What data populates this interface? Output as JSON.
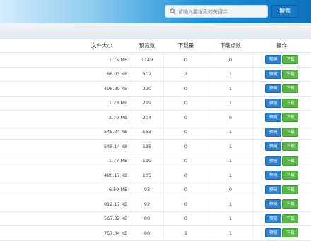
{
  "search": {
    "placeholder": "请输入要搜索的关键字...",
    "button_label": "搜索"
  },
  "table": {
    "columns": [
      "文件大小",
      "预览数",
      "下载量",
      "下载点数",
      "操作"
    ],
    "preview_label": "预览",
    "download_label": "下载",
    "rows": [
      {
        "size": "1.75 MB",
        "previews": "1149",
        "downloads": "0",
        "points": "0"
      },
      {
        "size": "88.03 KB",
        "previews": "302",
        "downloads": "2",
        "points": "1"
      },
      {
        "size": "495.89 KB",
        "previews": "290",
        "downloads": "0",
        "points": "1"
      },
      {
        "size": "1.23 MB",
        "previews": "219",
        "downloads": "0",
        "points": "1"
      },
      {
        "size": "2.70 MB",
        "previews": "204",
        "downloads": "0",
        "points": "0"
      },
      {
        "size": "545.24 KB",
        "previews": "163",
        "downloads": "0",
        "points": "1"
      },
      {
        "size": "545.14 KB",
        "previews": "135",
        "downloads": "0",
        "points": "1"
      },
      {
        "size": "1.77 MB",
        "previews": "119",
        "downloads": "0",
        "points": "1"
      },
      {
        "size": "480.17 KB",
        "previews": "105",
        "downloads": "0",
        "points": "1"
      },
      {
        "size": "6.59 MB",
        "previews": "93",
        "downloads": "0",
        "points": "0"
      },
      {
        "size": "912.17 KB",
        "previews": "92",
        "downloads": "0",
        "points": "1"
      },
      {
        "size": "567.32 KB",
        "previews": "80",
        "downloads": "0",
        "points": "1"
      },
      {
        "size": "757.04 KB",
        "previews": "80",
        "downloads": "1",
        "points": "1"
      }
    ]
  },
  "icons": {
    "search": "search-icon"
  },
  "colors": {
    "header_accent": "#0e73be",
    "preview_button": "#2f7fc9",
    "download_button": "#58b845"
  }
}
